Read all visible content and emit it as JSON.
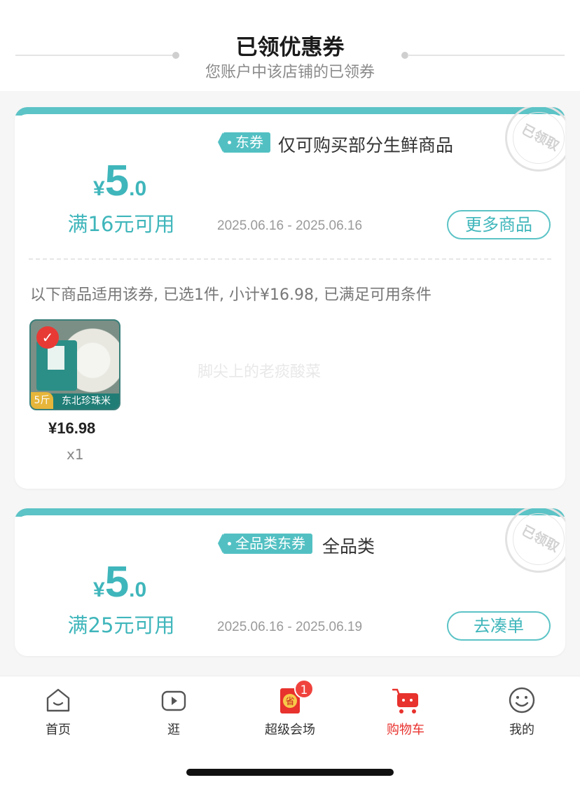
{
  "header": {
    "title": "已领优惠券",
    "subtitle": "您账户中该店铺的已领券"
  },
  "coupons": [
    {
      "currency": "¥",
      "amount_int": "5",
      "amount_dec": ".0",
      "threshold": "满16元可用",
      "tag": "东券",
      "description": "仅可购买部分生鲜商品",
      "date_range": "2025.06.16 - 2025.06.16",
      "action": "更多商品",
      "stamp": "已领取",
      "applies_text": "以下商品适用该券, 已选1件, 小计¥16.98, 已满足可用条件",
      "product": {
        "badge": "5斤",
        "name": "东北珍珠米",
        "price": "¥16.98",
        "qty": "x1"
      }
    },
    {
      "currency": "¥",
      "amount_int": "5",
      "amount_dec": ".0",
      "threshold": "满25元可用",
      "tag": "全品类东券",
      "description": "全品类",
      "date_range": "2025.06.16 - 2025.06.19",
      "action": "去凑单",
      "stamp": "已领取"
    }
  ],
  "watermark": "脚尖上的老痰酸菜",
  "tabbar": {
    "items": [
      {
        "label": "首页",
        "icon": "home-icon"
      },
      {
        "label": "逛",
        "icon": "video-play-icon"
      },
      {
        "label": "超级会场",
        "icon": "red-envelope-icon",
        "badge": "1"
      },
      {
        "label": "购物车",
        "icon": "shopping-cart-icon",
        "active": true
      },
      {
        "label": "我的",
        "icon": "smiley-face-icon"
      }
    ]
  },
  "colors": {
    "accent": "#3fb6bb",
    "active_tab": "#e8322d",
    "badge": "#f0423d"
  }
}
